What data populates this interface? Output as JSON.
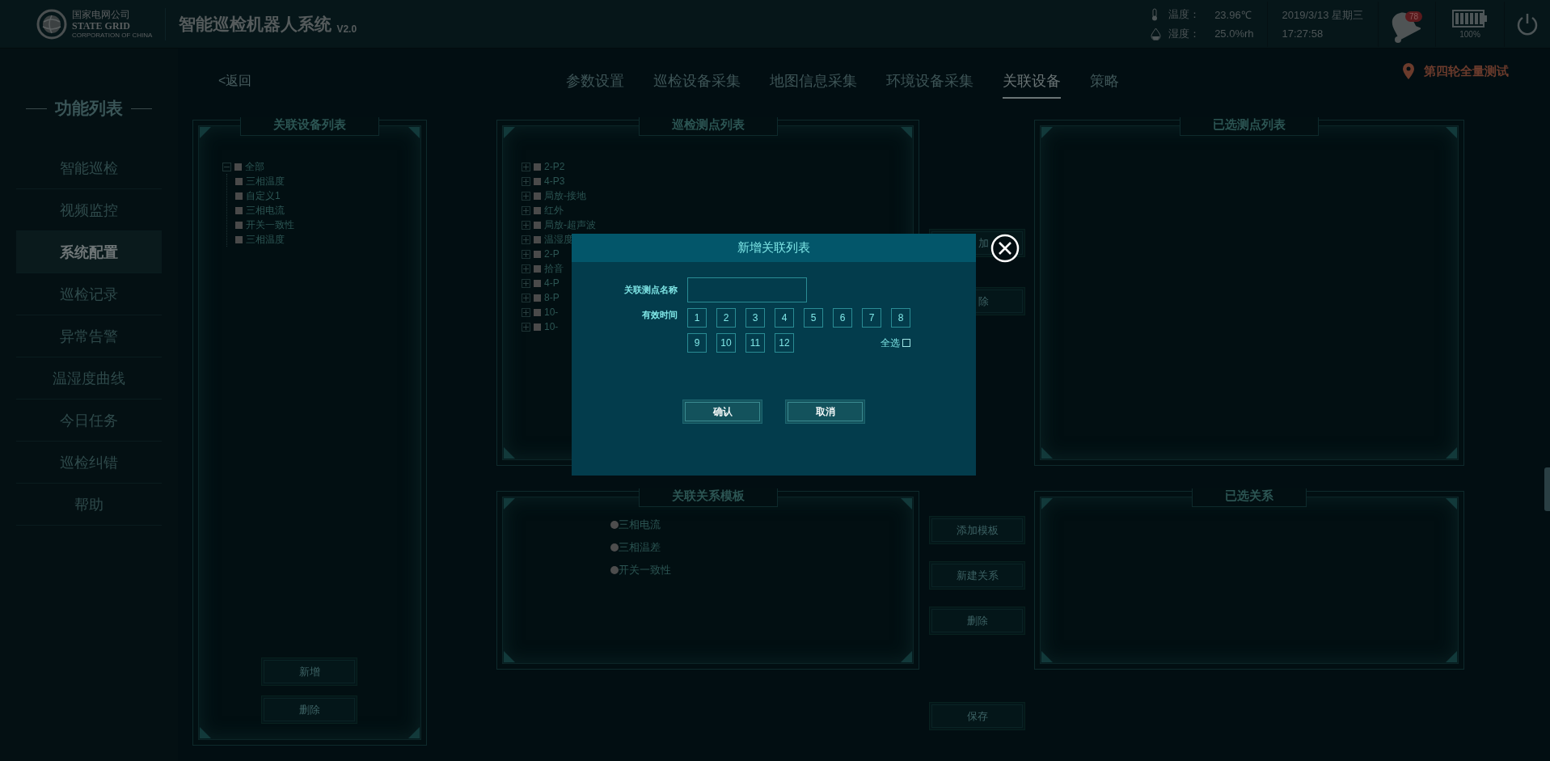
{
  "header": {
    "org_name": "国家电网公司",
    "org_name_en": "STATE GRID",
    "org_subtitle": "CORPORATION OF CHINA",
    "title": "智能巡检机器人系统",
    "version": "V2.0",
    "temperature_label": "温度：",
    "temperature": "23.96℃",
    "humidity_label": "湿度：",
    "humidity": "25.0%rh",
    "date": "2019/3/13 星期三",
    "time": "17:27:58",
    "alarm_count": "78",
    "battery": "100%"
  },
  "sidebar": {
    "title": "功能列表",
    "items": [
      {
        "label": "智能巡检",
        "selected": false
      },
      {
        "label": "视频监控",
        "selected": false
      },
      {
        "label": "系统配置",
        "selected": true
      },
      {
        "label": "巡检记录",
        "selected": false
      },
      {
        "label": "异常告警",
        "selected": false
      },
      {
        "label": "温湿度曲线",
        "selected": false
      },
      {
        "label": "今日任务",
        "selected": false
      },
      {
        "label": "巡检纠错",
        "selected": false
      },
      {
        "label": "帮助",
        "selected": false
      }
    ]
  },
  "back_link": "<返回",
  "tabs": [
    {
      "label": "参数设置",
      "selected": false
    },
    {
      "label": "巡检设备采集",
      "selected": false
    },
    {
      "label": "地图信息采集",
      "selected": false
    },
    {
      "label": "环境设备采集",
      "selected": false
    },
    {
      "label": "关联设备",
      "selected": true
    },
    {
      "label": "策略",
      "selected": false
    }
  ],
  "location": "第四轮全量测试",
  "device_panel": {
    "title": "关联设备列表",
    "tree": {
      "label": "全部",
      "expanded": true,
      "checked": false,
      "children": [
        {
          "label": "三相温度",
          "checked": false
        },
        {
          "label": "自定义1",
          "checked": false
        },
        {
          "label": "三相电流",
          "checked": false
        },
        {
          "label": "开关一致性",
          "checked": false
        },
        {
          "label": "三相温度",
          "checked": false
        }
      ]
    },
    "buttons": [
      "新增",
      "删除"
    ]
  },
  "point_panel": {
    "title": "巡检测点列表",
    "items": [
      {
        "label": "2-P2",
        "expanded": false,
        "checked": false
      },
      {
        "label": "4-P3",
        "expanded": false,
        "checked": false
      },
      {
        "label": "局放-接地",
        "expanded": false,
        "checked": false
      },
      {
        "label": "红外",
        "expanded": false,
        "checked": false
      },
      {
        "label": "局放-超声波",
        "expanded": false,
        "checked": false
      },
      {
        "label": "温湿度",
        "expanded": false,
        "checked": false
      },
      {
        "label": "2-P",
        "expanded": false,
        "checked": false
      },
      {
        "label": "拾音",
        "expanded": false,
        "checked": false
      },
      {
        "label": "4-P",
        "expanded": false,
        "checked": false
      },
      {
        "label": "8-P",
        "expanded": false,
        "checked": false
      },
      {
        "label": "10-",
        "expanded": false,
        "checked": false
      },
      {
        "label": "10-",
        "expanded": false,
        "checked": false
      }
    ]
  },
  "point_buttons": [
    "加",
    "除"
  ],
  "selected_points_panel": {
    "title": "已选测点列表"
  },
  "template_panel": {
    "title": "关联关系模板",
    "options": [
      {
        "label": "三相电流",
        "selected": false
      },
      {
        "label": "三相温差",
        "selected": false
      },
      {
        "label": "开关一致性",
        "selected": false
      }
    ]
  },
  "relation_buttons": [
    "添加模板",
    "新建关系",
    "删除"
  ],
  "save_button": "保存",
  "relations_panel": {
    "title": "已选关系"
  },
  "dialog": {
    "title": "新增关联列表",
    "name_label": "关联测点名称",
    "time_label": "有效时间",
    "hours": [
      {
        "label": "1",
        "selected": false
      },
      {
        "label": "2",
        "selected": false
      },
      {
        "label": "3",
        "selected": false
      },
      {
        "label": "4",
        "selected": false
      },
      {
        "label": "5",
        "selected": false
      },
      {
        "label": "6",
        "selected": false
      },
      {
        "label": "7",
        "selected": false
      },
      {
        "label": "8",
        "selected": false
      },
      {
        "label": "9",
        "selected": false
      },
      {
        "label": "10",
        "selected": false
      },
      {
        "label": "11",
        "selected": false
      },
      {
        "label": "12",
        "selected": false
      }
    ],
    "select_all": {
      "label": "全选",
      "checked": false
    },
    "buttons": [
      "确认",
      "取消"
    ]
  }
}
